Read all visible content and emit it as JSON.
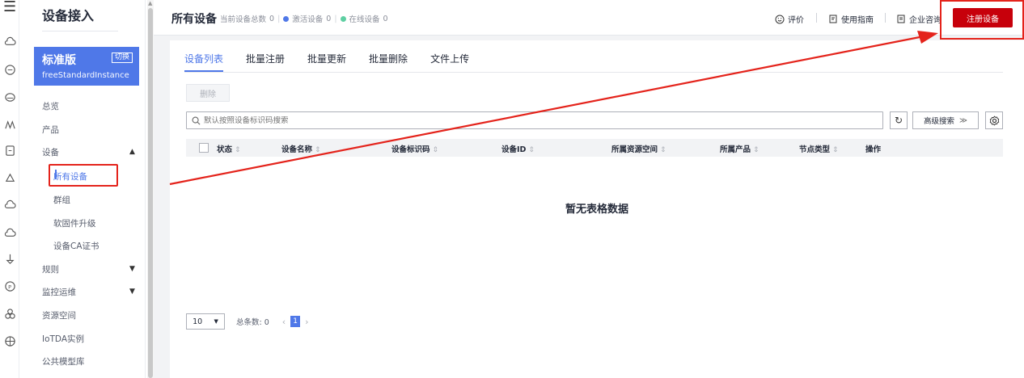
{
  "rail": {
    "menu_icon": "menu-icon",
    "icons": [
      "cloud-icon",
      "cloud-icon",
      "cloud-icon",
      "chart-icon",
      "document-icon",
      "cloud-icon",
      "cloud-icon",
      "cloud-icon",
      "flask-icon",
      "circle-p-icon",
      "link-icon",
      "globe-icon"
    ]
  },
  "sidebar": {
    "title": "设备接入",
    "edition": {
      "name": "标准版",
      "switch_label": "切换",
      "instance": "freeStandardInstance"
    },
    "items": [
      {
        "label": "总览"
      },
      {
        "label": "产品"
      },
      {
        "label": "设备",
        "expanded": true
      },
      {
        "label": "规则"
      },
      {
        "label": "监控运维"
      },
      {
        "label": "资源空间"
      },
      {
        "label": "IoTDA实例"
      },
      {
        "label": "公共模型库"
      }
    ],
    "sub_items": [
      {
        "label": "所有设备",
        "active": true
      },
      {
        "label": "群组"
      },
      {
        "label": "软固件升级"
      },
      {
        "label": "设备CA证书"
      }
    ]
  },
  "header": {
    "title": "所有设备",
    "stats": {
      "total_label": "当前设备总数",
      "total_value": "0",
      "active_label": "激活设备",
      "active_value": "0",
      "online_label": "在线设备",
      "online_value": "0"
    },
    "actions": {
      "rate": "评价",
      "guide": "使用指南",
      "consult": "企业咨询"
    },
    "register_button": "注册设备"
  },
  "tabs": [
    "设备列表",
    "批量注册",
    "批量更新",
    "批量删除",
    "文件上传"
  ],
  "toolbar": {
    "delete_button": "删除",
    "search_placeholder": "默认按照设备标识码搜索",
    "advanced_search": "高级搜索"
  },
  "table": {
    "columns": [
      "状态",
      "设备名称",
      "设备标识码",
      "设备ID",
      "所属资源空间",
      "所属产品",
      "节点类型",
      "操作"
    ],
    "empty_text": "暂无表格数据"
  },
  "pagination": {
    "page_size": "10",
    "total_label": "总条数: 0",
    "current_page": "1"
  },
  "colors": {
    "brand_red": "#c7000b",
    "accent_blue": "#4f78e8",
    "annotation_red": "#e4231b",
    "active_dot": "#4f78e8",
    "online_dot": "#5ecfa2"
  }
}
